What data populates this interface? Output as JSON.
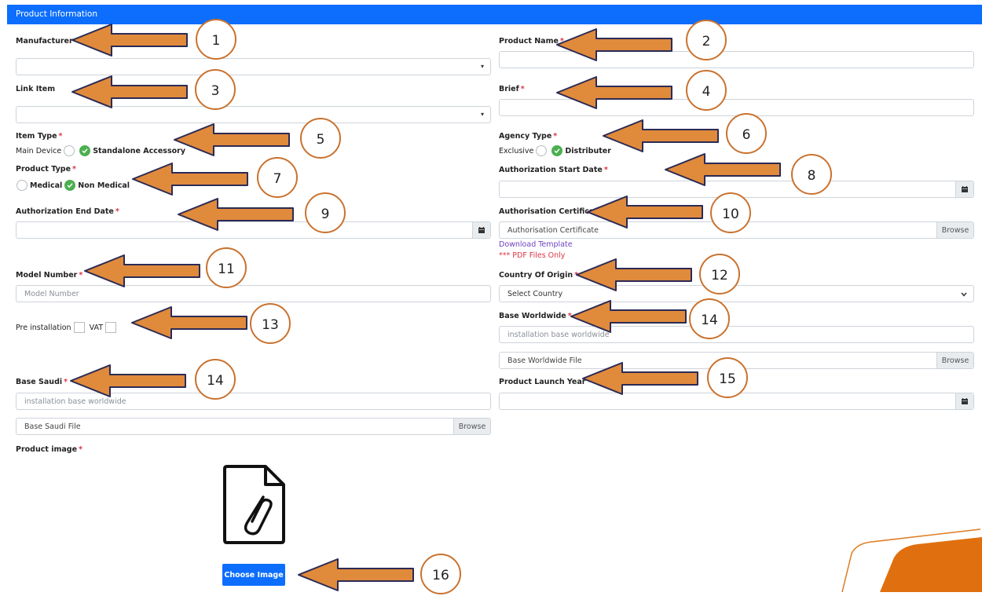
{
  "header": {
    "title": "Product Information"
  },
  "left": {
    "manufacturer_label": "Manufacturer",
    "link_item_label": "Link Item",
    "item_type_label": "Item Type",
    "item_type_options": [
      "Main Device",
      "Standalone Accessory"
    ],
    "item_type_selected": "Standalone Accessory",
    "product_type_label": "Product Type",
    "product_type_options": [
      "Medical",
      "Non Medical"
    ],
    "product_type_selected": "Non Medical",
    "auth_end_label": "Authorization End Date",
    "model_number_label": "Model Number",
    "model_number_placeholder": "Model Number",
    "pre_installation_label": "Pre installation",
    "vat_label": "VAT",
    "base_saudi_label": "Base Saudi",
    "base_saudi_placeholder": "installation base worldwide",
    "base_saudi_file_placeholder": "Base Saudi File",
    "browse": "Browse",
    "product_image_label": "Product image",
    "choose_image": "Choose Image"
  },
  "right": {
    "product_name_label": "Product Name",
    "brief_label": "Brief",
    "agency_type_label": "Agency Type",
    "agency_type_options": [
      "Exclusive",
      "Distributer"
    ],
    "agency_type_selected": "Distributer",
    "auth_start_label": "Authorization Start Date",
    "auth_cert_label": "Authorisation Certificate",
    "auth_cert_placeholder": "Authorisation Certificate",
    "browse": "Browse",
    "download_template": "Download Template",
    "pdf_only": "*** PDF Files Only",
    "country_label": "Country Of Origin",
    "country_value": "Select Country",
    "base_worldwide_label": "Base Worldwide",
    "base_worldwide_placeholder": "installation base worldwide",
    "base_worldwide_file_placeholder": "Base Worldwide File",
    "launch_year_label": "Product Launch Year"
  },
  "required_mark": "*",
  "annotations": [
    "1",
    "2",
    "3",
    "4",
    "5",
    "6",
    "7",
    "8",
    "9",
    "10",
    "11",
    "12",
    "13",
    "14",
    "14",
    "15",
    "16"
  ],
  "colors": {
    "header": "#0d6efd",
    "arrow": "#e08a3c",
    "check": "#4caf50",
    "required": "#dc3545"
  }
}
